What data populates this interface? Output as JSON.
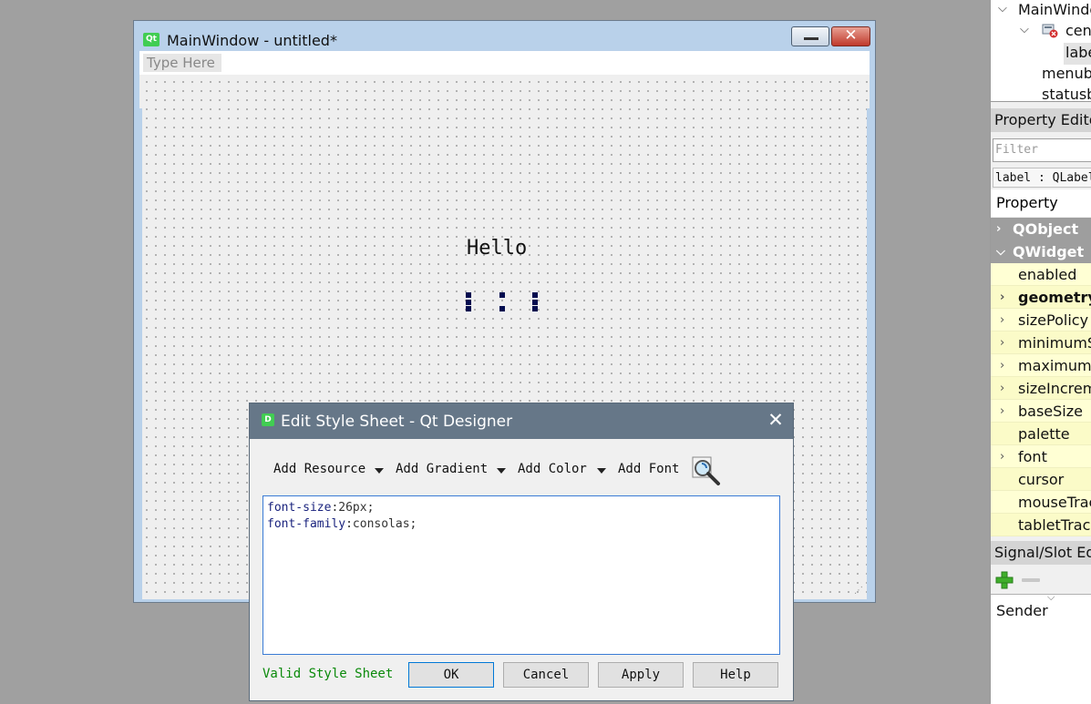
{
  "main_window": {
    "app_icon": "Qt",
    "title": "MainWindow - untitled*",
    "type_here": "Type Here",
    "label_text": "Hello"
  },
  "dialog": {
    "app_icon": "D",
    "title": "Edit Style Sheet - Qt Designer",
    "close_symbol": "✕",
    "toolbar": {
      "add_resource": "Add Resource",
      "add_gradient": "Add Gradient",
      "add_color": "Add Color",
      "add_font": "Add Font"
    },
    "editor_lines": [
      {
        "prop": "font-size",
        "value": ":26px;"
      },
      {
        "prop": "font-family",
        "value": ":consolas;"
      }
    ],
    "status": "Valid Style Sheet",
    "buttons": {
      "ok": "OK",
      "cancel": "Cancel",
      "apply": "Apply",
      "help": "Help"
    }
  },
  "object_inspector": {
    "items": [
      "MainWindo",
      "cent",
      "labe",
      "menub",
      "statusb"
    ]
  },
  "property_editor": {
    "header": "Property Edito",
    "filter_placeholder": "Filter",
    "object_class": "label : QLabel",
    "column": "Property",
    "groups": [
      "QObject",
      "QWidget"
    ],
    "properties": [
      {
        "name": "enabled",
        "expandable": false,
        "bold": false
      },
      {
        "name": "geometry",
        "expandable": true,
        "bold": true
      },
      {
        "name": "sizePolicy",
        "expandable": true,
        "bold": false
      },
      {
        "name": "minimumS",
        "expandable": true,
        "bold": false
      },
      {
        "name": "maximumS",
        "expandable": true,
        "bold": false
      },
      {
        "name": "sizeIncrem",
        "expandable": true,
        "bold": false
      },
      {
        "name": "baseSize",
        "expandable": true,
        "bold": false
      },
      {
        "name": "palette",
        "expandable": false,
        "bold": false
      },
      {
        "name": "font",
        "expandable": true,
        "bold": false
      },
      {
        "name": "cursor",
        "expandable": false,
        "bold": false
      },
      {
        "name": "mouseTrac",
        "expandable": false,
        "bold": false
      },
      {
        "name": "tabletTrack",
        "expandable": false,
        "bold": false
      }
    ]
  },
  "signal_slot_editor": {
    "header": "Signal/Slot Ed",
    "column_sender": "Sender"
  },
  "colors": {
    "property_row": "#ffffd4",
    "group_row": "#9e9e9e",
    "dialog_title": "#667788",
    "valid_text": "#0a8a0a"
  }
}
